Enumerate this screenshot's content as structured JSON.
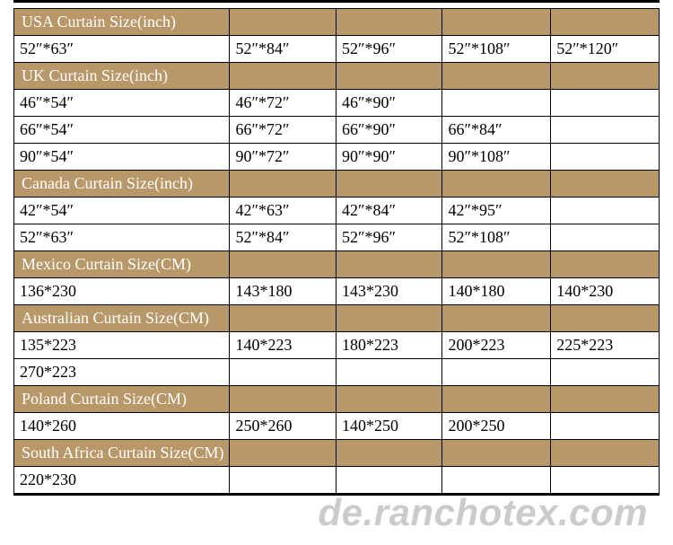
{
  "watermark": "de.ranchotex.com",
  "sections": [
    {
      "title": "USA Curtain Size(inch)",
      "rows": [
        [
          "52″*63″",
          "52″*84″",
          "52″*96″",
          "52″*108″",
          "52″*120″"
        ]
      ]
    },
    {
      "title": "UK Curtain Size(inch)",
      "rows": [
        [
          "46″*54″",
          "46″*72″",
          "46″*90″",
          "",
          ""
        ],
        [
          "66″*54″",
          "66″*72″",
          "66″*90″",
          "66″*84″",
          ""
        ],
        [
          "90″*54″",
          "90″*72″",
          "90″*90″",
          "90″*108″",
          ""
        ]
      ]
    },
    {
      "title": "Canada Curtain Size(inch)",
      "rows": [
        [
          "42″*54″",
          "42″*63″",
          "42″*84″",
          "42″*95″",
          ""
        ],
        [
          "52″*63″",
          "52″*84″",
          "52″*96″",
          "52″*108″",
          ""
        ]
      ]
    },
    {
      "title": "Mexico Curtain Size(CM)",
      "rows": [
        [
          "136*230",
          "143*180",
          "143*230",
          "140*180",
          "140*230"
        ]
      ]
    },
    {
      "title": "Australian Curtain Size(CM)",
      "rows": [
        [
          "135*223",
          "140*223",
          "180*223",
          "200*223",
          "225*223"
        ],
        [
          "270*223",
          "",
          "",
          "",
          ""
        ]
      ]
    },
    {
      "title": "Poland Curtain Size(CM)",
      "rows": [
        [
          "140*260",
          "250*260",
          "140*250",
          "200*250",
          ""
        ]
      ]
    },
    {
      "title": "South Africa Curtain Size(CM)",
      "rows": [
        [
          "220*230",
          "",
          "",
          "",
          ""
        ]
      ]
    }
  ]
}
